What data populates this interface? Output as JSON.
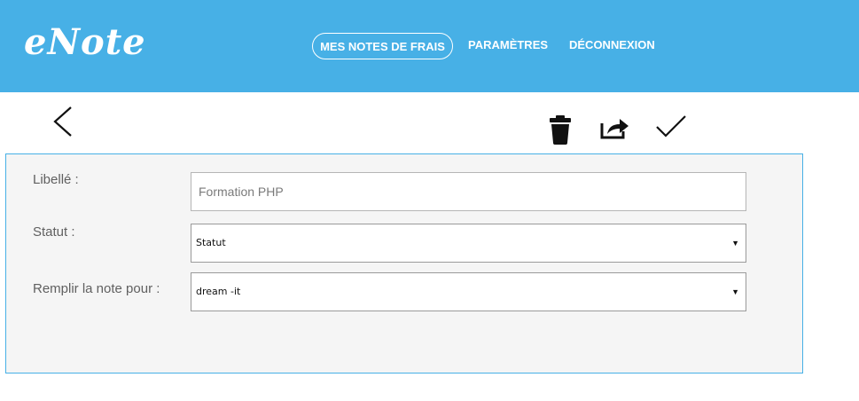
{
  "app": {
    "logo": "eNote"
  },
  "nav": {
    "items": [
      {
        "label": "MES NOTES DE FRAIS",
        "active": true
      },
      {
        "label": "PARAMÈTRES"
      },
      {
        "label": "DÉCONNEXION"
      }
    ]
  },
  "toolbar": {
    "icons": [
      "chevron-left-icon",
      "trash-icon",
      "share-icon",
      "check-icon"
    ]
  },
  "form": {
    "libelle": {
      "label": "Libellé :",
      "placeholder": "Formation PHP",
      "value": ""
    },
    "statut": {
      "label": "Statut :",
      "selected": "Statut"
    },
    "remplir": {
      "label": "Remplir la note pour :",
      "selected": "dream -it"
    }
  },
  "colors": {
    "header": "#47b0e6",
    "panel": "#f5f5f5",
    "panel_border": "#47b0e6"
  }
}
